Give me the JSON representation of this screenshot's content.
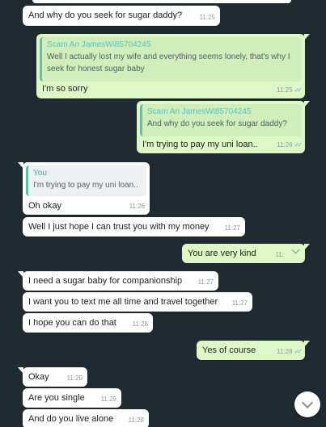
{
  "colors": {
    "background": "#1f2a31",
    "incoming_bubble": "#ffffff",
    "outgoing_bubble": "#dcf8c6",
    "quote_author": "#5cc3c8",
    "read_ticks": "#4fb5e8"
  },
  "messages": [
    {
      "text": "And why do you seek for sugar daddy?",
      "time": "11:25"
    },
    {
      "quote_author": "Scam An JamesWi85704245",
      "quote_text": "Well I actually lost my wife and everything seems lonely, that's why I seek for honest sugar baby",
      "text": "I'm so sorry",
      "time": "11:25"
    },
    {
      "quote_author": "Scam An JamesWi85704245",
      "quote_text": "And why do you seek for sugar daddy?",
      "text": "I'm trying to pay my uni loan..",
      "time": "11:26"
    },
    {
      "quote_author": "You",
      "quote_text": "I'm trying to pay my uni loan..",
      "text": "Oh okay",
      "time": "11:26"
    },
    {
      "text": "Well I just hope I can trust you with my money",
      "time": "11:27"
    },
    {
      "text": "You are very kind",
      "time": "11:"
    },
    {
      "text": "I need a sugar baby for companionship",
      "time": "11:27"
    },
    {
      "text": "I want you to text me all time and travel together",
      "time": "11:27"
    },
    {
      "text": "I hope you can do that",
      "time": "11:28"
    },
    {
      "text": "Yes of course",
      "time": "11:28"
    },
    {
      "text": "Okay",
      "time": "11:29"
    },
    {
      "text": "Are you single",
      "time": "11:29"
    },
    {
      "text": "And do you live alone",
      "time": "11:29"
    }
  ],
  "icons": {
    "read_receipt": "double-check-icon",
    "scroll_down": "chevron-down-icon",
    "message_menu": "chevron-down-icon"
  }
}
